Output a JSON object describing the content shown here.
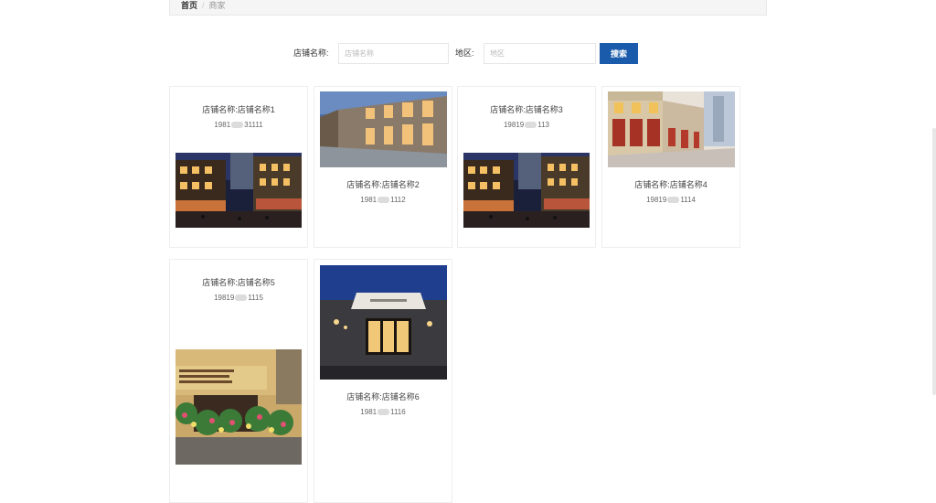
{
  "breadcrumb": {
    "home": "首页",
    "separator": "/",
    "current": "商家"
  },
  "search": {
    "shop_label": "店铺名称:",
    "shop_placeholder": "店铺名称",
    "region_label": "地区:",
    "region_placeholder": "地区",
    "button": "搜索"
  },
  "cards": [
    {
      "name": "店铺名称:店铺名称1",
      "phone_prefix": "1981",
      "phone_suffix": "31111",
      "image": "night-street-photo"
    },
    {
      "name": "店铺名称:店铺名称2",
      "phone_prefix": "1981",
      "phone_suffix": "1112",
      "image": "storefront-dusk-photo"
    },
    {
      "name": "店铺名称:店铺名称3",
      "phone_prefix": "19819",
      "phone_suffix": "113",
      "image": "night-street-photo"
    },
    {
      "name": "店铺名称:店铺名称4",
      "phone_prefix": "19819",
      "phone_suffix": "1114",
      "image": "shopping-street-photo"
    },
    {
      "name": "店铺名称:店铺名称5",
      "phone_prefix": "19819",
      "phone_suffix": "1115",
      "image": "flower-shop-photo"
    },
    {
      "name": "店铺名称:店铺名称6",
      "phone_prefix": "1981",
      "phone_suffix": "1116",
      "image": "boutique-night-photo"
    }
  ],
  "colors": {
    "accent": "#1b5bab"
  }
}
